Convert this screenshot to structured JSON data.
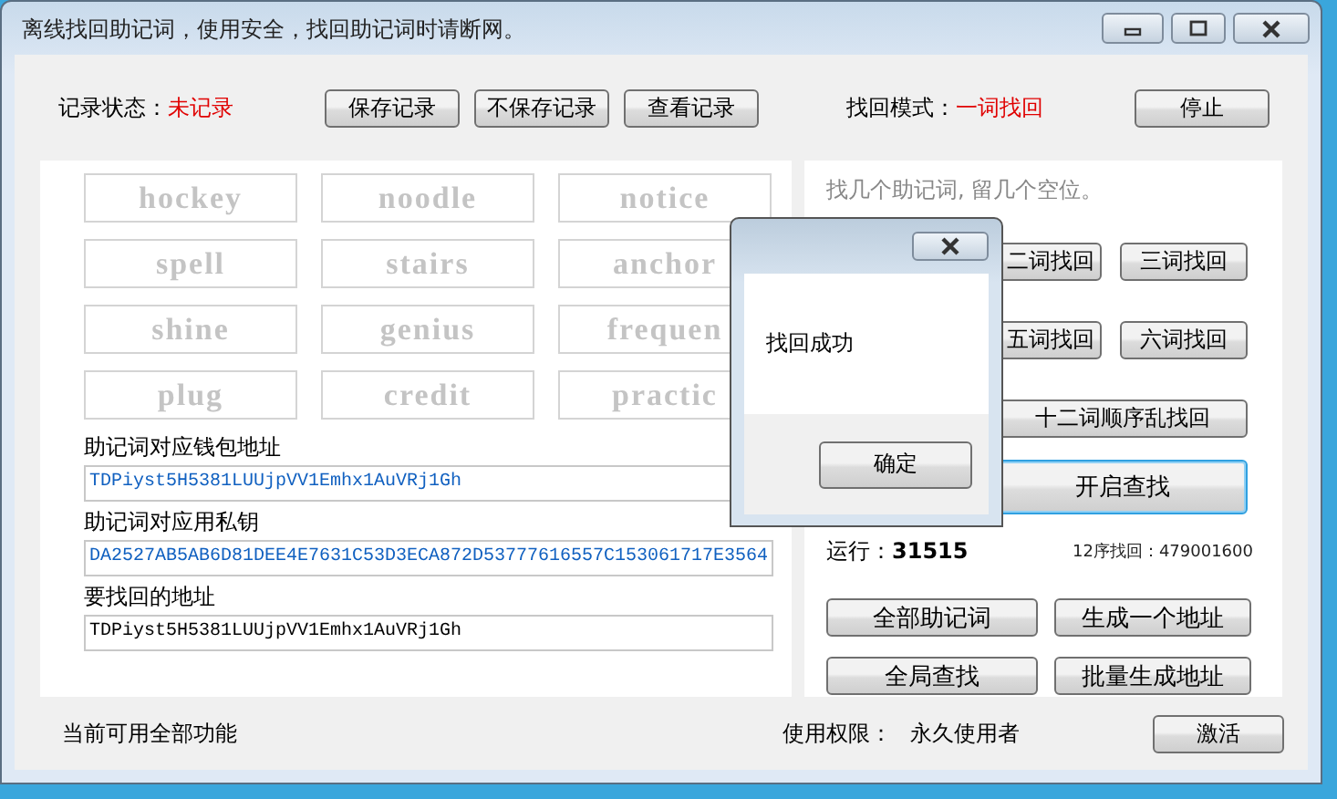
{
  "window": {
    "title": "离线找回助记词，使用安全，找回助记词时请断网。"
  },
  "record_status": {
    "label": "记录状态：",
    "value": "未记录"
  },
  "record_buttons": [
    "保存记录",
    "不保存记录",
    "查看记录"
  ],
  "mode": {
    "label": "找回模式：",
    "value": "一词找回"
  },
  "stop_button": "停止",
  "words": [
    "hockey",
    "noodle",
    "notice",
    "spell",
    "stairs",
    "anchor",
    "shine",
    "genius",
    "frequen",
    "plug",
    "credit",
    "practic"
  ],
  "fields": [
    {
      "label": "助记词对应钱包地址",
      "value": "TDPiyst5H5381LUUjpVV1Emhx1AuVRj1Gh",
      "kind": "output"
    },
    {
      "label": "助记词对应用私钥",
      "value": "DA2527AB5AB6D81DEE4E7631C53D3ECA872D53777616557C153061717E3564",
      "kind": "output"
    },
    {
      "label": "要找回的地址",
      "value": "TDPiyst5H5381LUUjpVV1Emhx1AuVRj1Gh",
      "kind": "input"
    }
  ],
  "hint": "找几个助记词, 留几个空位。",
  "recover_rows": [
    {
      "buttons": [
        {
          "label": "二词找回",
          "focused": false
        },
        {
          "label": "三词找回",
          "focused": false
        }
      ]
    },
    {
      "buttons": [
        {
          "label": "五词找回",
          "focused": false
        },
        {
          "label": "六词找回",
          "focused": false
        }
      ]
    },
    {
      "buttons": [
        {
          "label": "十二词顺序乱找回",
          "focused": false
        }
      ]
    },
    {
      "buttons": [
        {
          "label": "开启查找",
          "focused": true
        }
      ]
    }
  ],
  "run": {
    "label": "运行：",
    "value": "31515"
  },
  "order": {
    "label": "12序找回：",
    "value": "479001600"
  },
  "action_buttons": [
    "全部助记词",
    "生成一个地址",
    "全局查找",
    "批量生成地址"
  ],
  "status_text": "当前可用全部功能",
  "license": {
    "label": "使用权限：",
    "value": "永久使用者"
  },
  "activate_button": "激活",
  "dialog": {
    "message": "找回成功",
    "button": "确定"
  }
}
